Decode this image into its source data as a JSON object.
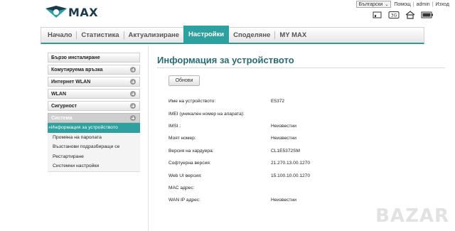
{
  "header": {
    "logo_text": "MAX",
    "language": "Български",
    "links": [
      "Помощ",
      "admin",
      "Изход"
    ],
    "status_icons": [
      "signal-icon",
      "3g-icon",
      "home-icon",
      "battery-icon"
    ]
  },
  "nav": {
    "tabs": [
      {
        "label": "Начало"
      },
      {
        "label": "Статистика"
      },
      {
        "label": "Актуализиране"
      },
      {
        "label": "Настройки",
        "active": true
      },
      {
        "label": "Споделяне"
      },
      {
        "label": "MY MAX"
      }
    ]
  },
  "sidebar": {
    "groups": [
      {
        "label": "Бързо инсталиране"
      },
      {
        "label": "Комутируема връзка"
      },
      {
        "label": "Интернет WLAN"
      },
      {
        "label": "WLAN"
      },
      {
        "label": "Сигурност"
      },
      {
        "label": "Система"
      }
    ],
    "system_items": [
      {
        "label": "»Информация за устройството",
        "active": true
      },
      {
        "label": "Промяна на паролата"
      },
      {
        "label": "Възстанови подразбиращи се"
      },
      {
        "label": "Рестартиране"
      },
      {
        "label": "Системни настройки"
      }
    ]
  },
  "main": {
    "title": "Информация за устройството",
    "refresh_label": "Обнови",
    "rows": [
      {
        "label": "Име на устройството:",
        "value": "E5372"
      },
      {
        "label": "IMEI (уникален номер на апарата):",
        "value": ""
      },
      {
        "label": "IMSI :",
        "value": "Неизвестни"
      },
      {
        "label": "Моят номер:",
        "value": "Неизвестни"
      },
      {
        "label": "Версия на хардуера:",
        "value": "CL1E5372SM"
      },
      {
        "label": "Софтуерна версия:",
        "value": "21.270.13.00.1270"
      },
      {
        "label": "Web UI версия:",
        "value": "15.100.10.00.1270"
      },
      {
        "label": "MAC адрес:",
        "value": ""
      },
      {
        "label": "WAN IP адрес:",
        "value": "Неизвестни"
      }
    ]
  },
  "watermark": "BAZAR",
  "colors": {
    "accent": "#2fa0a0",
    "title": "#2b6b72"
  }
}
